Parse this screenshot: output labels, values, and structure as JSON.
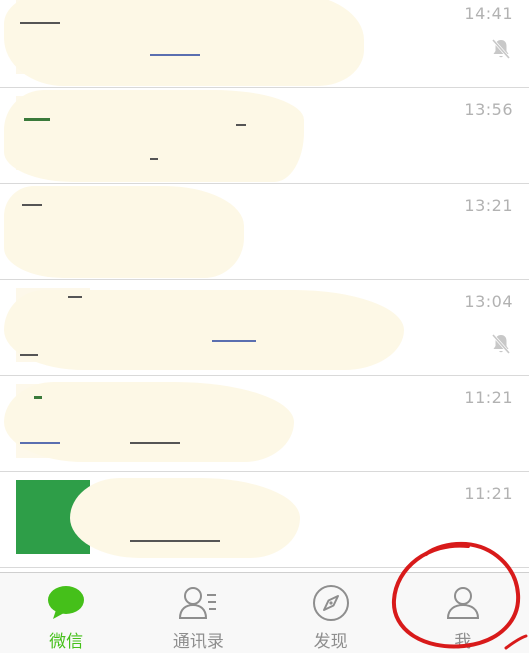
{
  "chats": [
    {
      "time": "14:41",
      "muted": true
    },
    {
      "time": "13:56",
      "muted": false
    },
    {
      "time": "13:21",
      "muted": false
    },
    {
      "time": "13:04",
      "muted": true
    },
    {
      "time": "11:21",
      "muted": false
    },
    {
      "time": "11:21",
      "muted": false
    }
  ],
  "tabs": [
    {
      "label": "微信",
      "icon": "chat-bubble-icon",
      "active": true
    },
    {
      "label": "通讯录",
      "icon": "contacts-icon",
      "active": false
    },
    {
      "label": "发现",
      "icon": "compass-icon",
      "active": false
    },
    {
      "label": "我",
      "icon": "person-icon",
      "active": false
    }
  ],
  "colors": {
    "accent": "#45c01a",
    "inactive": "#8e8e8e",
    "time": "#b2b2b2",
    "annotation": "#d81a1a"
  }
}
